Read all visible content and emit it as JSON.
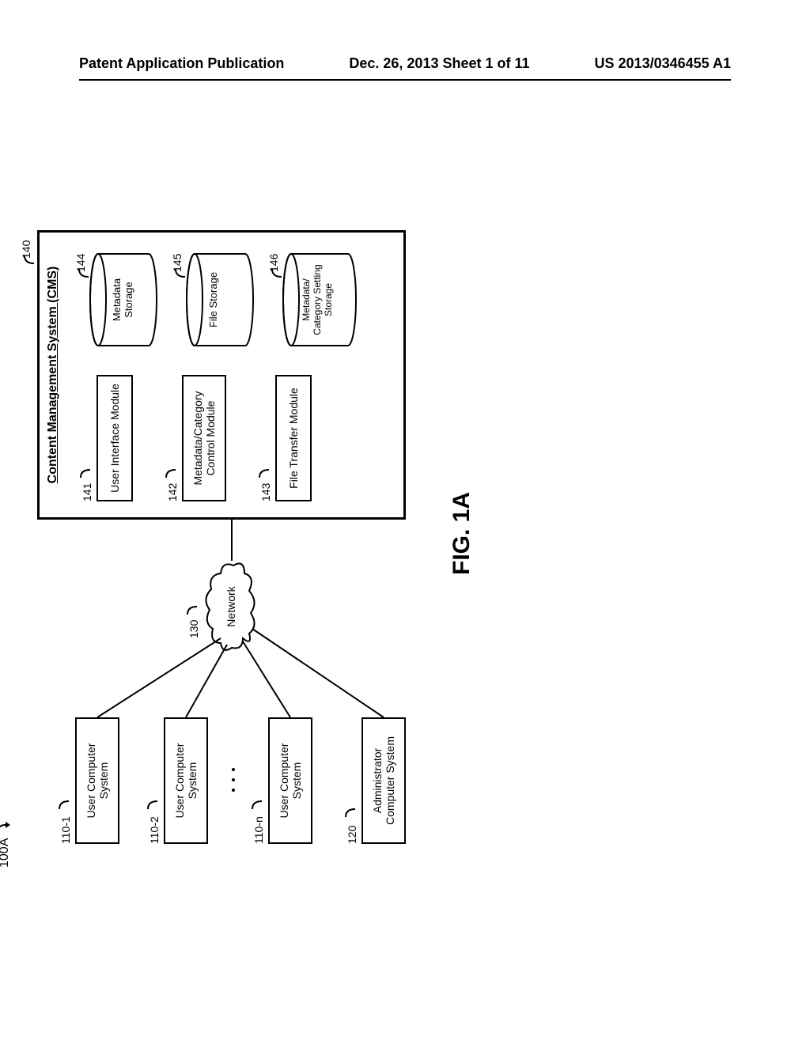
{
  "header": {
    "left": "Patent Application Publication",
    "center": "Dec. 26, 2013  Sheet 1 of 11",
    "right": "US 2013/0346455 A1"
  },
  "figure": {
    "number": "FIG. 1A",
    "overall_ref": "100A",
    "network": {
      "label": "Network",
      "ref": "130"
    },
    "clients": [
      {
        "label": "User Computer\nSystem",
        "ref": "110-1"
      },
      {
        "label": "User Computer\nSystem",
        "ref": "110-2"
      },
      {
        "label": "User Computer\nSystem",
        "ref": "110-n"
      },
      {
        "label": "Administrator\nComputer System",
        "ref": "120"
      }
    ],
    "cms": {
      "title": "Content Management System (CMS)",
      "ref": "140",
      "modules": [
        {
          "label": "User Interface Module",
          "ref": "141"
        },
        {
          "label": "Metadata/Category\nControl Module",
          "ref": "142"
        },
        {
          "label": "File Transfer Module",
          "ref": "143"
        }
      ],
      "storage": [
        {
          "label": "Metadata\nStorage",
          "ref": "144"
        },
        {
          "label": "File Storage",
          "ref": "145"
        },
        {
          "label": "Metadata/\nCategory Setting\nStorage",
          "ref": "146"
        }
      ]
    }
  }
}
